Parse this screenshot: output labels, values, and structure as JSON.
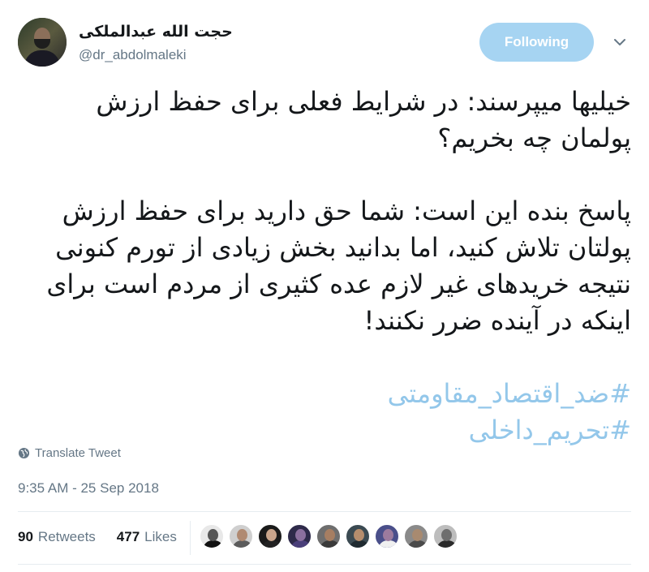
{
  "author": {
    "display_name": "حجت الله عبدالملکی",
    "handle": "@dr_abdolmaleki",
    "avatar_icon": "profile-photo"
  },
  "follow_button": {
    "label": "Following",
    "color": "#a6d4f2"
  },
  "menu_icon": "chevron-down-icon",
  "tweet": {
    "paragraph_1": "خیلیها میپرسند: در شرایط فعلی برای حفظ ارزش پولمان چه بخریم؟",
    "paragraph_2": "پاسخ بنده این است: شما حق دارید برای حفظ ارزش پولتان تلاش کنید، اما بدانید بخش زیادی از تورم کنونی نتیجه خریدهای غیر لازم عده کثیری از مردم است برای اینکه در آینده ضرر نکنند!",
    "hashtags": [
      "#ضد_اقتصاد_مقاومتی",
      "#تحریم_داخلی"
    ],
    "hashtag_color": "#93c7ea"
  },
  "translate_label": "Translate Tweet",
  "timestamp": "9:35 AM - 25 Sep 2018",
  "stats": {
    "retweets_count": "90",
    "retweets_label": "Retweets",
    "likes_count": "477",
    "likes_label": "Likes"
  },
  "likers": [
    {
      "skin": "#555555",
      "bg": "#e8e8e8",
      "cloth": "#111111"
    },
    {
      "skin": "#b08a72",
      "bg": "#cfcfcf",
      "cloth": "#5b5b5b"
    },
    {
      "skin": "#c9a48b",
      "bg": "#1a1a1a",
      "cloth": "#222222"
    },
    {
      "skin": "#8b6f9e",
      "bg": "#2e2a4a",
      "cloth": "#4a3f7a"
    },
    {
      "skin": "#a67e62",
      "bg": "#6e6e6e",
      "cloth": "#3a3a3a"
    },
    {
      "skin": "#b58d6d",
      "bg": "#3b4a52",
      "cloth": "#1f2a30"
    },
    {
      "skin": "#9c7b9e",
      "bg": "#4a4f8a",
      "cloth": "#f0f0f0"
    },
    {
      "skin": "#a88a70",
      "bg": "#8a8a8a",
      "cloth": "#4a4a4a"
    },
    {
      "skin": "#6e6e6e",
      "bg": "#bdbdbd",
      "cloth": "#2a2a2a"
    }
  ]
}
